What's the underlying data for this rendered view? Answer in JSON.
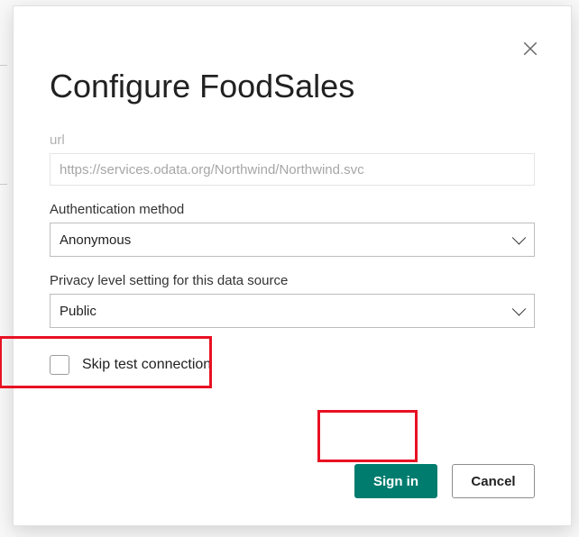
{
  "dialog": {
    "title": "Configure FoodSales",
    "fields": {
      "url": {
        "label": "url",
        "value": "https://services.odata.org/Northwind/Northwind.svc"
      },
      "auth": {
        "label": "Authentication method",
        "value": "Anonymous"
      },
      "privacy": {
        "label": "Privacy level setting for this data source",
        "value": "Public"
      },
      "skipTest": {
        "label": "Skip test connection",
        "checked": false
      }
    },
    "actions": {
      "primary": "Sign in",
      "secondary": "Cancel"
    }
  },
  "colors": {
    "accent": "#007c6f",
    "annotation": "#e81123"
  }
}
